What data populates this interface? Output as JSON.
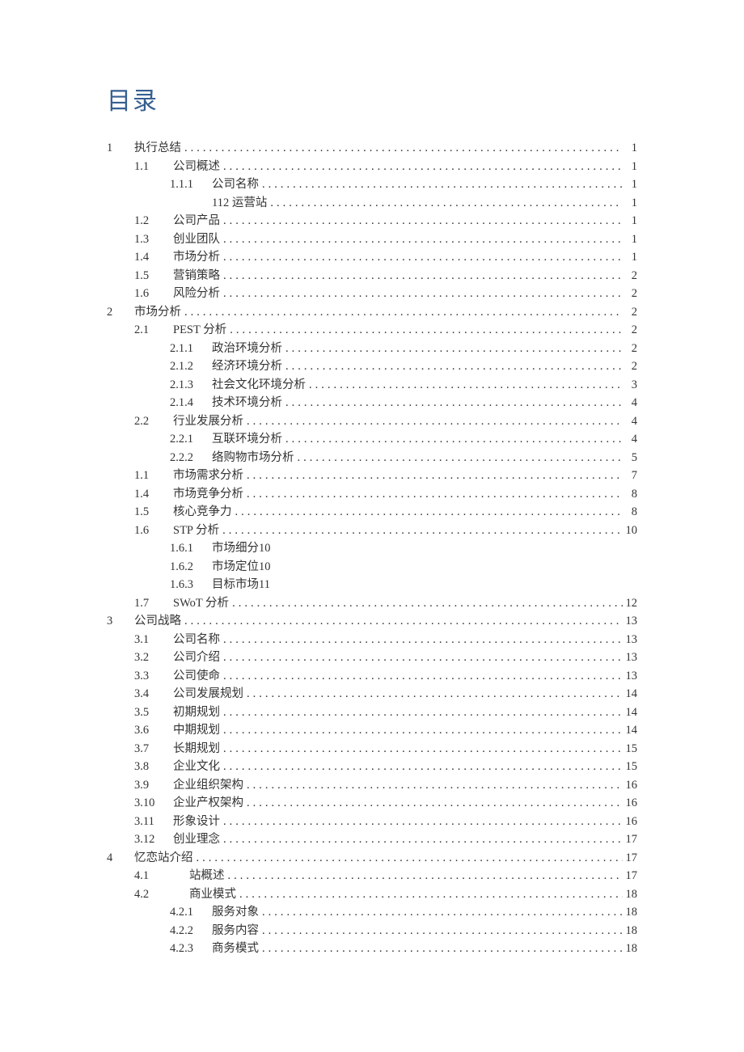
{
  "title": "目录",
  "entries": [
    {
      "level": 1,
      "num": "1",
      "text": "执行总结",
      "page": "1"
    },
    {
      "level": 2,
      "num": "1.1",
      "text": "公司概述",
      "page": "1"
    },
    {
      "level": 3,
      "num": "1.1.1",
      "text": "公司名称",
      "page": "1"
    },
    {
      "level": 3,
      "num": "",
      "text": "112 运营站",
      "page": "1"
    },
    {
      "level": 2,
      "num": "1.2",
      "text": "公司产品",
      "page": "1"
    },
    {
      "level": 2,
      "num": "1.3",
      "text": "创业团队",
      "page": "1"
    },
    {
      "level": 2,
      "num": "1.4",
      "text": "市场分析",
      "page": "1"
    },
    {
      "level": 2,
      "num": "1.5",
      "text": "营销策略",
      "page": "2"
    },
    {
      "level": 2,
      "num": "1.6",
      "text": "风险分析",
      "page": "2"
    },
    {
      "level": 1,
      "num": "2",
      "text": "市场分析",
      "page": "2"
    },
    {
      "level": 2,
      "num": "2.1",
      "text": "PEST 分析",
      "page": "2"
    },
    {
      "level": 3,
      "num": "2.1.1",
      "text": "政治环境分析",
      "page": "2"
    },
    {
      "level": 3,
      "num": "2.1.2",
      "text": "经济环境分析",
      "page": "2"
    },
    {
      "level": 3,
      "num": "2.1.3",
      "text": "社会文化环境分析",
      "page": "3"
    },
    {
      "level": 3,
      "num": "2.1.4",
      "text": "技术环境分析",
      "page": "4"
    },
    {
      "level": 2,
      "num": "2.2",
      "text": "行业发展分析",
      "page": "4"
    },
    {
      "level": 3,
      "num": "2.2.1",
      "text": "互联环境分析",
      "page": "4"
    },
    {
      "level": 3,
      "num": "2.2.2",
      "text": "络购物市场分析",
      "page": "5"
    },
    {
      "level": 2,
      "num": "1.1",
      "text": "市场需求分析",
      "page": "7"
    },
    {
      "level": 2,
      "num": "1.4",
      "text": "市场竞争分析",
      "page": "8"
    },
    {
      "level": 2,
      "num": "1.5",
      "text": "核心竞争力",
      "page": "8"
    },
    {
      "level": 2,
      "num": "1.6",
      "text": "STP 分析",
      "page": "10"
    },
    {
      "level": 3,
      "num": "1.6.1",
      "text": "市场细分10",
      "noleader": true
    },
    {
      "level": 3,
      "num": "1.6.2",
      "text": "市场定位10",
      "noleader": true
    },
    {
      "level": 3,
      "num": "1.6.3",
      "text": "目标市场11",
      "noleader": true
    },
    {
      "level": 2,
      "num": "1.7",
      "text": "SWoT 分析",
      "page": "12"
    },
    {
      "level": 1,
      "num": "3",
      "text": "公司战略",
      "page": "13"
    },
    {
      "level": 2,
      "num": "3.1",
      "text": "公司名称",
      "page": "13"
    },
    {
      "level": 2,
      "num": "3.2",
      "text": "公司介绍",
      "page": "13"
    },
    {
      "level": 2,
      "num": "3.3",
      "text": "公司使命",
      "page": "13"
    },
    {
      "level": 2,
      "num": "3.4",
      "text": "公司发展规划",
      "page": "14"
    },
    {
      "level": 2,
      "num": "3.5",
      "text": "初期规划",
      "page": "14"
    },
    {
      "level": 2,
      "num": "3.6",
      "text": "中期规划",
      "page": "14"
    },
    {
      "level": 2,
      "num": "3.7",
      "text": "长期规划",
      "page": "15"
    },
    {
      "level": 2,
      "num": "3.8",
      "text": "企业文化",
      "page": "15"
    },
    {
      "level": 2,
      "num": "3.9",
      "text": "企业组织架构",
      "page": "16"
    },
    {
      "level": 2,
      "num": "3.10",
      "text": "企业产权架构",
      "page": "16"
    },
    {
      "level": 2,
      "num": "3.11",
      "text": "形象设计",
      "page": "16"
    },
    {
      "level": 2,
      "num": "3.12",
      "text": "创业理念",
      "page": "17"
    },
    {
      "level": 1,
      "num": "4",
      "text": "忆恋站介绍",
      "page": "17"
    },
    {
      "level": 2,
      "num": "4.1",
      "text": "站概述",
      "page": "17",
      "extraIndent": true
    },
    {
      "level": 2,
      "num": "4.2",
      "text": "商业模式",
      "page": "18",
      "extraIndent": true
    },
    {
      "level": 3,
      "num": "4.2.1",
      "text": "服务对象",
      "page": "18"
    },
    {
      "level": 3,
      "num": "4.2.2",
      "text": "服务内容",
      "page": "18"
    },
    {
      "level": 3,
      "num": "4.2.3",
      "text": "商务模式",
      "page": "18"
    }
  ]
}
